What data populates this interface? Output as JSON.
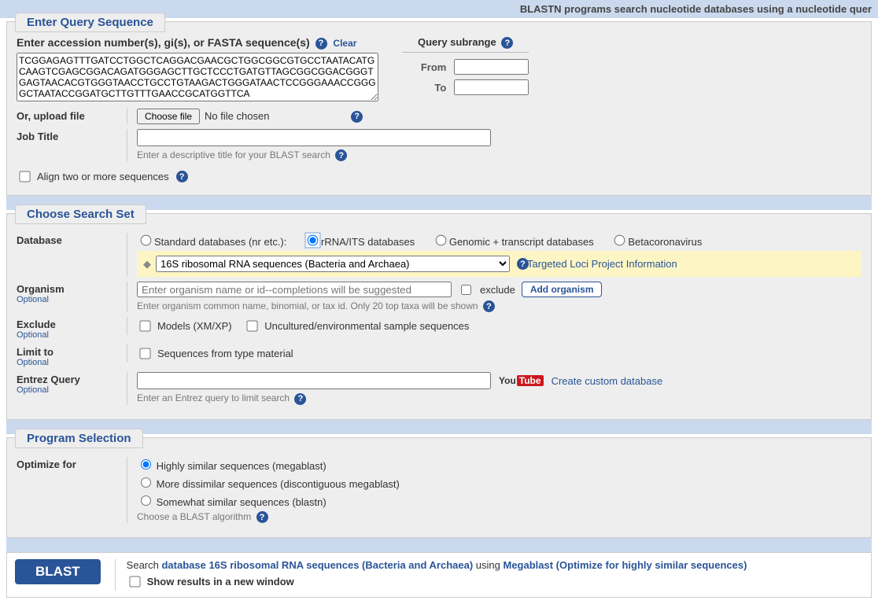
{
  "top_banner": "BLASTN programs search nucleotide databases using a nucleotide quer",
  "query": {
    "section_title": "Enter Query Sequence",
    "enter_label": "Enter accession number(s), gi(s), or FASTA sequence(s)",
    "clear": "Clear",
    "sequence_text": "TCGGAGAGTTTGATCCTGGCTCAGGACGAACGCTGGCGGCGTGCCTAATACATGCAAGTCGAGCGGACAGATGGGAGCTTGCTCCCTGATGTTAGCGGCGGACGGGTGAGTAACACGTGGGTAACCTGCCTGTAAGACTGGGATAACTCCGGGAAACCGGGGCTAATACCGGATGCTTGTTTGAACCGCATGGTTCA",
    "subrange_title": "Query subrange",
    "from_label": "From",
    "to_label": "To",
    "upload_label": "Or, upload file",
    "choose_file_btn": "Choose file",
    "no_file": "No file chosen",
    "job_title_label": "Job Title",
    "job_title_hint": "Enter a descriptive title for your BLAST search",
    "align_two_label": "Align two or more sequences"
  },
  "search_set": {
    "section_title": "Choose Search Set",
    "database_label": "Database",
    "db_options": {
      "standard": "Standard databases (nr etc.):",
      "rrna": "rRNA/ITS databases",
      "genomic": "Genomic + transcript databases",
      "beta": "Betacoronavirus"
    },
    "db_select_value": "16S ribosomal RNA sequences (Bacteria and Archaea)",
    "targeted_link": "Targeted Loci Project Information",
    "organism_label": "Organism",
    "organism_placeholder": "Enter organism name or id--completions will be suggested",
    "exclude_checkbox": "exclude",
    "add_organism": "Add organism",
    "organism_hint": "Enter organism common name, binomial, or tax id. Only 20 top taxa will be shown",
    "exclude_label": "Exclude",
    "exclude_models": "Models (XM/XP)",
    "exclude_uncultured": "Uncultured/environmental sample sequences",
    "limit_label": "Limit to",
    "limit_seq_type": "Sequences from type material",
    "entrez_label": "Entrez Query",
    "entrez_hint": "Enter an Entrez query to limit search",
    "custom_db_link": "Create custom database",
    "optional": "Optional"
  },
  "program": {
    "section_title": "Program Selection",
    "optimize_label": "Optimize for",
    "opts": {
      "mega": "Highly similar sequences (megablast)",
      "disc": "More dissimilar sequences (discontiguous megablast)",
      "blastn": "Somewhat similar sequences (blastn)"
    },
    "hint": "Choose a BLAST algorithm"
  },
  "footer": {
    "blast_btn": "BLAST",
    "search_prefix": "Search ",
    "database_text": "database 16S ribosomal RNA sequences (Bacteria and Archaea)",
    "using": " using ",
    "algo_text": "Megablast (Optimize for highly similar sequences)",
    "show_new_window": "Show results in a new window"
  }
}
